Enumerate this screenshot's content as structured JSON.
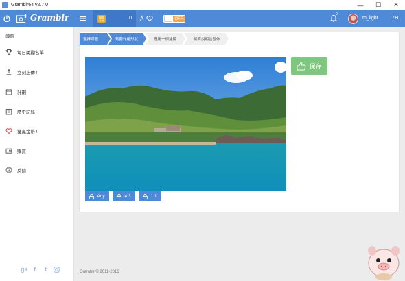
{
  "window": {
    "title": "Gramblr64 v2.7.0",
    "minimize": "—",
    "maximize": "☐",
    "close": "✕"
  },
  "appbar": {
    "brand": "Gramblr",
    "coins": "0",
    "ptag": "Ă",
    "toggle": "OFF",
    "notifications": "0",
    "username": "th_light",
    "language": "ZH"
  },
  "sidebar": {
    "title": "導航",
    "items": [
      {
        "label": "每日獎勵名單",
        "icon": "trophy-icon"
      },
      {
        "label": "立刻上傳 !",
        "icon": "upload-icon"
      },
      {
        "label": "計劃",
        "icon": "calendar-icon"
      },
      {
        "label": "歷史記錄",
        "icon": "history-icon"
      },
      {
        "label": "獲贏金幣 !",
        "icon": "heart-icon"
      },
      {
        "label": "購買",
        "icon": "wallet-icon"
      },
      {
        "label": "反饋",
        "icon": "help-icon"
      }
    ],
    "social": [
      "g+",
      "f",
      "t",
      "ig"
    ]
  },
  "steps": [
    {
      "label": "選擇媒體",
      "active": true
    },
    {
      "label": "裁剪作用形狀",
      "active": true
    },
    {
      "label": "應用一個濾鏡",
      "active": false
    },
    {
      "label": "編寫說明並發佈",
      "active": false
    }
  ],
  "save_label": "保存",
  "ratios": [
    "Any",
    "4:3",
    "1:1"
  ],
  "footer": "Gramblr © 2011-2016",
  "colors": {
    "primary": "#4f8ad9",
    "save": "#7dc77e",
    "toggle_off": "#f3a64b"
  }
}
